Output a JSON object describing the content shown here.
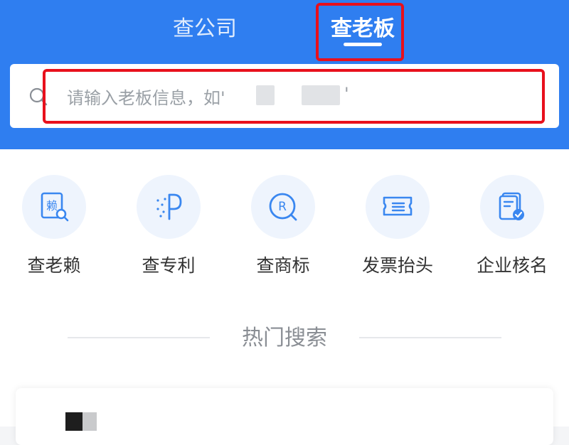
{
  "tabs": [
    {
      "label": "查公司",
      "active": false
    },
    {
      "label": "查老板",
      "active": true
    }
  ],
  "search": {
    "placeholder": "请输入老板信息，如'",
    "quote_end": "'"
  },
  "tools": [
    {
      "label": "查老赖",
      "icon": "dishonest-debtor-icon"
    },
    {
      "label": "查专利",
      "icon": "patent-icon"
    },
    {
      "label": "查商标",
      "icon": "trademark-icon"
    },
    {
      "label": "发票抬头",
      "icon": "invoice-icon"
    },
    {
      "label": "企业核名",
      "icon": "company-name-check-icon"
    }
  ],
  "hot": {
    "title": "热门搜索"
  },
  "colors": {
    "brand_blue": "#2f7ef0",
    "annotation_red": "#e8101c",
    "icon_blue": "#3a87f0",
    "icon_bg": "#eef4fd"
  }
}
